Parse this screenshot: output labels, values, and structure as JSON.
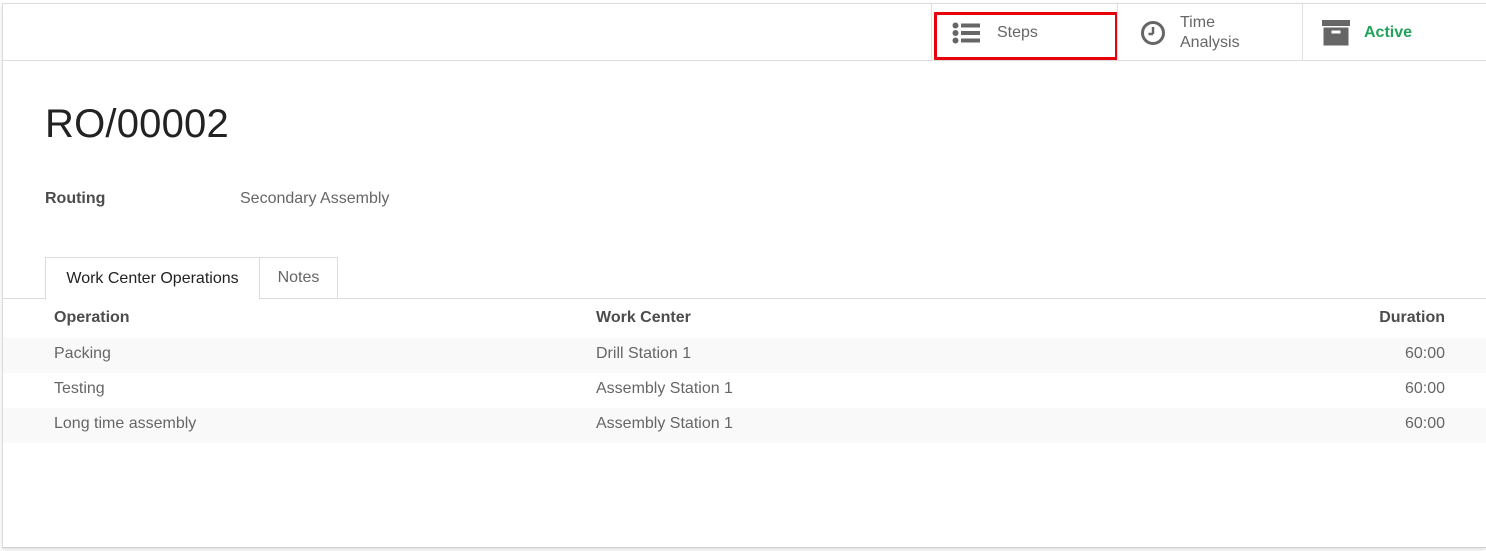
{
  "buttons": {
    "steps": "Steps",
    "time_analysis_line1": "Time",
    "time_analysis_line2": "Analysis",
    "active": "Active"
  },
  "record": {
    "title": "RO/00002",
    "routing_label": "Routing",
    "routing_value": "Secondary Assembly"
  },
  "tabs": [
    {
      "label": "Work Center Operations",
      "active": true
    },
    {
      "label": "Notes",
      "active": false
    }
  ],
  "table": {
    "headers": [
      "Operation",
      "Work Center",
      "Duration"
    ],
    "rows": [
      {
        "operation": "Packing",
        "work_center": "Drill Station 1",
        "duration": "60:00"
      },
      {
        "operation": "Testing",
        "work_center": "Assembly Station 1",
        "duration": "60:00"
      },
      {
        "operation": "Long time assembly",
        "work_center": "Assembly Station 1",
        "duration": "60:00"
      }
    ]
  },
  "icons": {
    "steps": "list-icon",
    "time": "clock-icon",
    "active": "archive-icon"
  },
  "colors": {
    "active_green": "#21a35b",
    "highlight_red": "#e8000a"
  }
}
